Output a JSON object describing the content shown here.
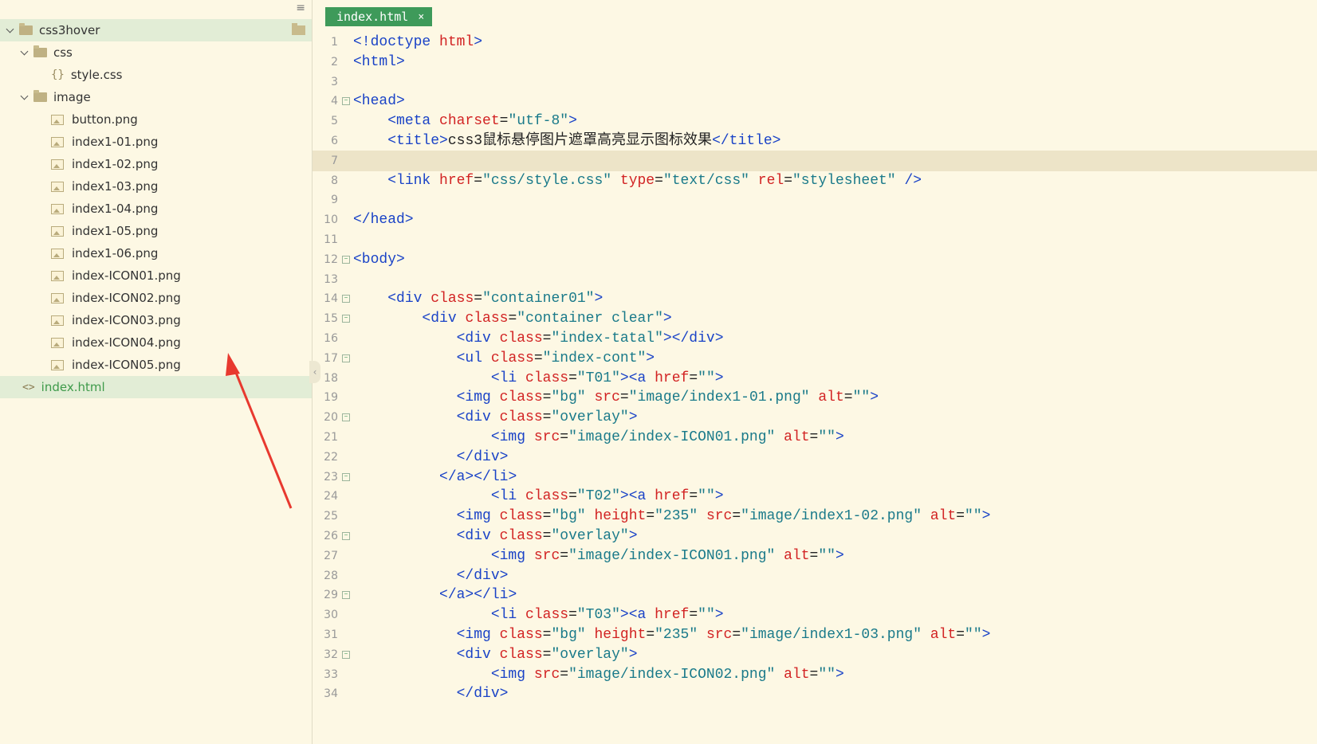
{
  "sidebar": {
    "root": "css3hover",
    "items": [
      {
        "kind": "folder",
        "label": "css",
        "depth": 1
      },
      {
        "kind": "css",
        "label": "style.css",
        "depth": 2
      },
      {
        "kind": "folder",
        "label": "image",
        "depth": 1
      },
      {
        "kind": "img",
        "label": "button.png",
        "depth": 2
      },
      {
        "kind": "img",
        "label": "index1-01.png",
        "depth": 2
      },
      {
        "kind": "img",
        "label": "index1-02.png",
        "depth": 2
      },
      {
        "kind": "img",
        "label": "index1-03.png",
        "depth": 2
      },
      {
        "kind": "img",
        "label": "index1-04.png",
        "depth": 2
      },
      {
        "kind": "img",
        "label": "index1-05.png",
        "depth": 2
      },
      {
        "kind": "img",
        "label": "index1-06.png",
        "depth": 2
      },
      {
        "kind": "img",
        "label": "index-ICON01.png",
        "depth": 2
      },
      {
        "kind": "img",
        "label": "index-ICON02.png",
        "depth": 2
      },
      {
        "kind": "img",
        "label": "index-ICON03.png",
        "depth": 2
      },
      {
        "kind": "img",
        "label": "index-ICON04.png",
        "depth": 2
      },
      {
        "kind": "img",
        "label": "index-ICON05.png",
        "depth": 2
      },
      {
        "kind": "html",
        "label": "index.html",
        "depth": 1
      }
    ]
  },
  "tab": {
    "label": "index.html",
    "close": "×"
  },
  "colors": {
    "accent": "#3e9a5a",
    "background": "#fdf8e4",
    "current_line": "#ede4c8",
    "arrow": "#e8392f"
  },
  "code_lines": [
    {
      "n": "1",
      "s": [
        [
          "t",
          "<!doctype "
        ],
        [
          "a",
          "html"
        ],
        [
          "t",
          ">"
        ]
      ]
    },
    {
      "n": "2",
      "s": [
        [
          "t",
          "<html>"
        ]
      ]
    },
    {
      "n": "3",
      "s": []
    },
    {
      "n": "4",
      "fold": true,
      "s": [
        [
          "t",
          "<head>"
        ]
      ]
    },
    {
      "n": "5",
      "s": [
        [
          "x",
          "    "
        ],
        [
          "t",
          "<meta "
        ],
        [
          "a",
          "charset"
        ],
        [
          "x",
          "="
        ],
        [
          "v",
          "\"utf-8\""
        ],
        [
          "t",
          ">"
        ]
      ]
    },
    {
      "n": "6",
      "s": [
        [
          "x",
          "    "
        ],
        [
          "t",
          "<title>"
        ],
        [
          "x",
          "css3鼠标悬停图片遮罩高亮显示图标效果"
        ],
        [
          "t",
          "</title>"
        ]
      ]
    },
    {
      "n": "7",
      "current": true,
      "s": []
    },
    {
      "n": "8",
      "s": [
        [
          "x",
          "    "
        ],
        [
          "t",
          "<link "
        ],
        [
          "a",
          "href"
        ],
        [
          "x",
          "="
        ],
        [
          "v",
          "\"css/style.css\""
        ],
        [
          "x",
          " "
        ],
        [
          "a",
          "type"
        ],
        [
          "x",
          "="
        ],
        [
          "v",
          "\"text/css\""
        ],
        [
          "x",
          " "
        ],
        [
          "a",
          "rel"
        ],
        [
          "x",
          "="
        ],
        [
          "v",
          "\"stylesheet\""
        ],
        [
          "x",
          " "
        ],
        [
          "t",
          "/>"
        ]
      ]
    },
    {
      "n": "9",
      "s": []
    },
    {
      "n": "10",
      "s": [
        [
          "t",
          "</head>"
        ]
      ]
    },
    {
      "n": "11",
      "s": []
    },
    {
      "n": "12",
      "fold": true,
      "s": [
        [
          "t",
          "<body>"
        ]
      ]
    },
    {
      "n": "13",
      "s": []
    },
    {
      "n": "14",
      "fold": true,
      "s": [
        [
          "x",
          "    "
        ],
        [
          "t",
          "<div "
        ],
        [
          "a",
          "class"
        ],
        [
          "x",
          "="
        ],
        [
          "v",
          "\"container01\""
        ],
        [
          "t",
          ">"
        ]
      ]
    },
    {
      "n": "15",
      "fold": true,
      "s": [
        [
          "x",
          "        "
        ],
        [
          "t",
          "<div "
        ],
        [
          "a",
          "class"
        ],
        [
          "x",
          "="
        ],
        [
          "v",
          "\"container clear\""
        ],
        [
          "t",
          ">"
        ]
      ]
    },
    {
      "n": "16",
      "s": [
        [
          "x",
          "            "
        ],
        [
          "t",
          "<div "
        ],
        [
          "a",
          "class"
        ],
        [
          "x",
          "="
        ],
        [
          "v",
          "\"index-tatal\""
        ],
        [
          "t",
          "></div>"
        ]
      ]
    },
    {
      "n": "17",
      "fold": true,
      "s": [
        [
          "x",
          "            "
        ],
        [
          "t",
          "<ul "
        ],
        [
          "a",
          "class"
        ],
        [
          "x",
          "="
        ],
        [
          "v",
          "\"index-cont\""
        ],
        [
          "t",
          ">"
        ]
      ]
    },
    {
      "n": "18",
      "s": [
        [
          "x",
          "                "
        ],
        [
          "t",
          "<li "
        ],
        [
          "a",
          "class"
        ],
        [
          "x",
          "="
        ],
        [
          "v",
          "\"T01\""
        ],
        [
          "t",
          "><a "
        ],
        [
          "a",
          "href"
        ],
        [
          "x",
          "="
        ],
        [
          "v",
          "\"\""
        ],
        [
          "t",
          ">"
        ]
      ]
    },
    {
      "n": "19",
      "s": [
        [
          "x",
          "            "
        ],
        [
          "t",
          "<img "
        ],
        [
          "a",
          "class"
        ],
        [
          "x",
          "="
        ],
        [
          "v",
          "\"bg\""
        ],
        [
          "x",
          " "
        ],
        [
          "a",
          "src"
        ],
        [
          "x",
          "="
        ],
        [
          "v",
          "\"image/index1-01.png\""
        ],
        [
          "x",
          " "
        ],
        [
          "a",
          "alt"
        ],
        [
          "x",
          "="
        ],
        [
          "v",
          "\"\""
        ],
        [
          "t",
          ">"
        ]
      ]
    },
    {
      "n": "20",
      "fold": true,
      "s": [
        [
          "x",
          "            "
        ],
        [
          "t",
          "<div "
        ],
        [
          "a",
          "class"
        ],
        [
          "x",
          "="
        ],
        [
          "v",
          "\"overlay\""
        ],
        [
          "t",
          ">"
        ]
      ]
    },
    {
      "n": "21",
      "s": [
        [
          "x",
          "                "
        ],
        [
          "t",
          "<img "
        ],
        [
          "a",
          "src"
        ],
        [
          "x",
          "="
        ],
        [
          "v",
          "\"image/index-ICON01.png\""
        ],
        [
          "x",
          " "
        ],
        [
          "a",
          "alt"
        ],
        [
          "x",
          "="
        ],
        [
          "v",
          "\"\""
        ],
        [
          "t",
          ">"
        ]
      ]
    },
    {
      "n": "22",
      "s": [
        [
          "x",
          "            "
        ],
        [
          "t",
          "</div>"
        ]
      ]
    },
    {
      "n": "23",
      "fold": true,
      "s": [
        [
          "x",
          "          "
        ],
        [
          "t",
          "</a></li>"
        ]
      ]
    },
    {
      "n": "24",
      "s": [
        [
          "x",
          "                "
        ],
        [
          "t",
          "<li "
        ],
        [
          "a",
          "class"
        ],
        [
          "x",
          "="
        ],
        [
          "v",
          "\"T02\""
        ],
        [
          "t",
          "><a "
        ],
        [
          "a",
          "href"
        ],
        [
          "x",
          "="
        ],
        [
          "v",
          "\"\""
        ],
        [
          "t",
          ">"
        ]
      ]
    },
    {
      "n": "25",
      "s": [
        [
          "x",
          "            "
        ],
        [
          "t",
          "<img "
        ],
        [
          "a",
          "class"
        ],
        [
          "x",
          "="
        ],
        [
          "v",
          "\"bg\""
        ],
        [
          "x",
          " "
        ],
        [
          "a",
          "height"
        ],
        [
          "x",
          "="
        ],
        [
          "v",
          "\"235\""
        ],
        [
          "x",
          " "
        ],
        [
          "a",
          "src"
        ],
        [
          "x",
          "="
        ],
        [
          "v",
          "\"image/index1-02.png\""
        ],
        [
          "x",
          " "
        ],
        [
          "a",
          "alt"
        ],
        [
          "x",
          "="
        ],
        [
          "v",
          "\"\""
        ],
        [
          "t",
          ">"
        ]
      ]
    },
    {
      "n": "26",
      "fold": true,
      "s": [
        [
          "x",
          "            "
        ],
        [
          "t",
          "<div "
        ],
        [
          "a",
          "class"
        ],
        [
          "x",
          "="
        ],
        [
          "v",
          "\"overlay\""
        ],
        [
          "t",
          ">"
        ]
      ]
    },
    {
      "n": "27",
      "s": [
        [
          "x",
          "                "
        ],
        [
          "t",
          "<img "
        ],
        [
          "a",
          "src"
        ],
        [
          "x",
          "="
        ],
        [
          "v",
          "\"image/index-ICON01.png\""
        ],
        [
          "x",
          " "
        ],
        [
          "a",
          "alt"
        ],
        [
          "x",
          "="
        ],
        [
          "v",
          "\"\""
        ],
        [
          "t",
          ">"
        ]
      ]
    },
    {
      "n": "28",
      "s": [
        [
          "x",
          "            "
        ],
        [
          "t",
          "</div>"
        ]
      ]
    },
    {
      "n": "29",
      "fold": true,
      "s": [
        [
          "x",
          "          "
        ],
        [
          "t",
          "</a></li>"
        ]
      ]
    },
    {
      "n": "30",
      "s": [
        [
          "x",
          "                "
        ],
        [
          "t",
          "<li "
        ],
        [
          "a",
          "class"
        ],
        [
          "x",
          "="
        ],
        [
          "v",
          "\"T03\""
        ],
        [
          "t",
          "><a "
        ],
        [
          "a",
          "href"
        ],
        [
          "x",
          "="
        ],
        [
          "v",
          "\"\""
        ],
        [
          "t",
          ">"
        ]
      ]
    },
    {
      "n": "31",
      "s": [
        [
          "x",
          "            "
        ],
        [
          "t",
          "<img "
        ],
        [
          "a",
          "class"
        ],
        [
          "x",
          "="
        ],
        [
          "v",
          "\"bg\""
        ],
        [
          "x",
          " "
        ],
        [
          "a",
          "height"
        ],
        [
          "x",
          "="
        ],
        [
          "v",
          "\"235\""
        ],
        [
          "x",
          " "
        ],
        [
          "a",
          "src"
        ],
        [
          "x",
          "="
        ],
        [
          "v",
          "\"image/index1-03.png\""
        ],
        [
          "x",
          " "
        ],
        [
          "a",
          "alt"
        ],
        [
          "x",
          "="
        ],
        [
          "v",
          "\"\""
        ],
        [
          "t",
          ">"
        ]
      ]
    },
    {
      "n": "32",
      "fold": true,
      "s": [
        [
          "x",
          "            "
        ],
        [
          "t",
          "<div "
        ],
        [
          "a",
          "class"
        ],
        [
          "x",
          "="
        ],
        [
          "v",
          "\"overlay\""
        ],
        [
          "t",
          ">"
        ]
      ]
    },
    {
      "n": "33",
      "s": [
        [
          "x",
          "                "
        ],
        [
          "t",
          "<img "
        ],
        [
          "a",
          "src"
        ],
        [
          "x",
          "="
        ],
        [
          "v",
          "\"image/index-ICON02.png\""
        ],
        [
          "x",
          " "
        ],
        [
          "a",
          "alt"
        ],
        [
          "x",
          "="
        ],
        [
          "v",
          "\"\""
        ],
        [
          "t",
          ">"
        ]
      ]
    },
    {
      "n": "34",
      "s": [
        [
          "x",
          "            "
        ],
        [
          "t",
          "</div>"
        ]
      ]
    }
  ]
}
